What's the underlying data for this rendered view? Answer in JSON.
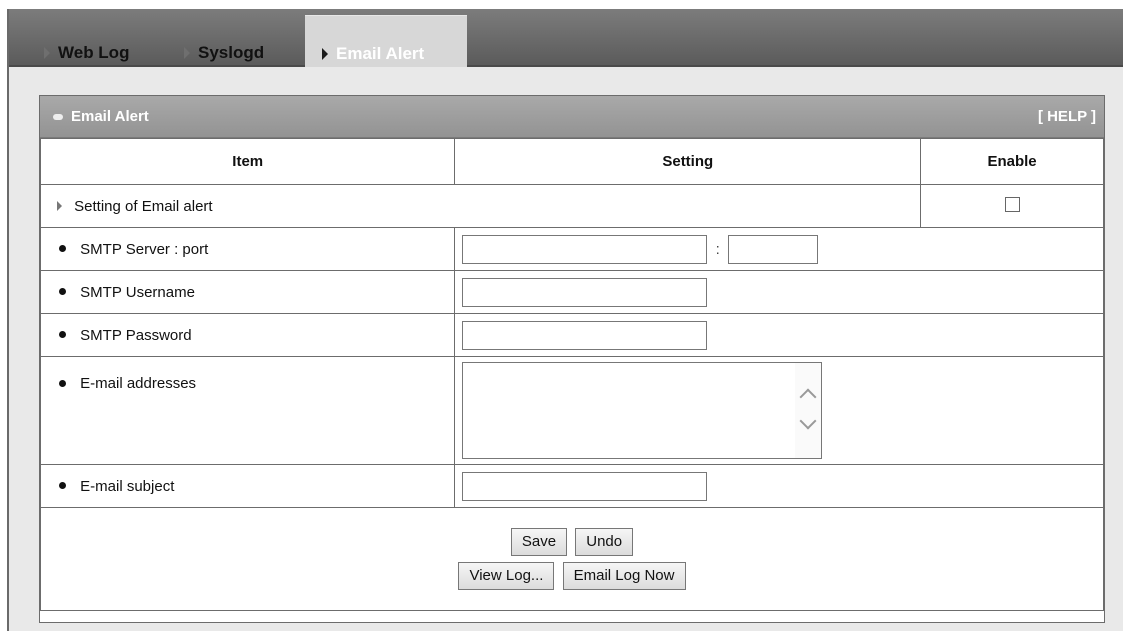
{
  "tabs": [
    {
      "label": "Web Log",
      "active": false
    },
    {
      "label": "Syslogd",
      "active": false
    },
    {
      "label": "Email Alert",
      "active": true
    }
  ],
  "panel": {
    "title": "Email Alert",
    "help": "[ HELP ]"
  },
  "table": {
    "headers": {
      "item": "Item",
      "setting": "Setting",
      "enable": "Enable"
    },
    "section_label": "Setting of Email alert",
    "section_enabled": false,
    "rows": {
      "smtp_server": {
        "label": "SMTP Server : port",
        "server_value": "",
        "port_value": "",
        "separator": ":"
      },
      "smtp_username": {
        "label": "SMTP Username",
        "value": ""
      },
      "smtp_password": {
        "label": "SMTP Password",
        "value": ""
      },
      "email_addresses": {
        "label": "E-mail addresses",
        "value": ""
      },
      "email_subject": {
        "label": "E-mail subject",
        "value": ""
      }
    }
  },
  "buttons": {
    "save": "Save",
    "undo": "Undo",
    "view_log": "View Log...",
    "email_log_now": "Email Log Now"
  },
  "colors": {
    "tabbar": "#6b6b6b",
    "active_tab": "#d7d7d7",
    "panel_header": "#9e9e9e"
  }
}
